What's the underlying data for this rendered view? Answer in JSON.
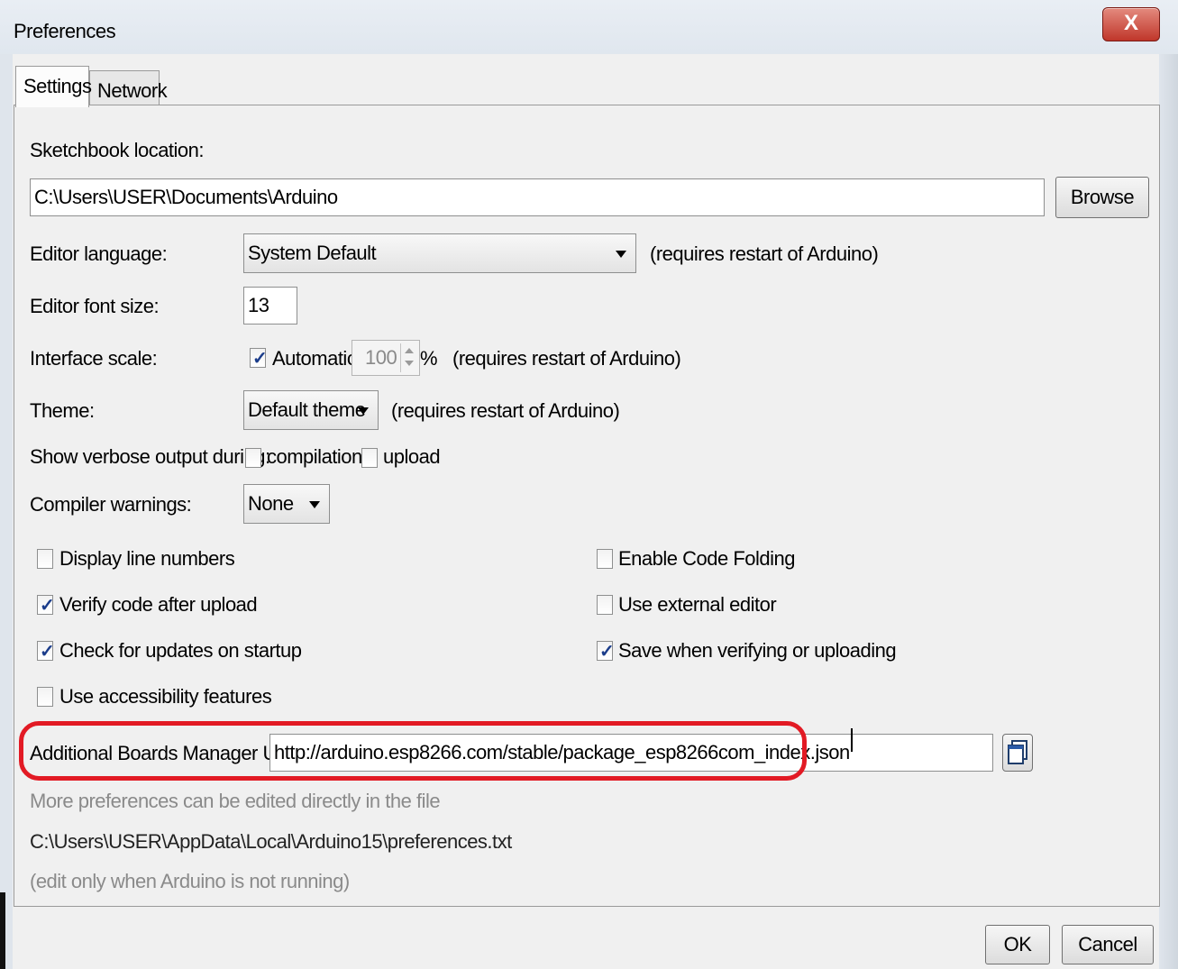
{
  "window": {
    "title": "Preferences",
    "close_label": "X"
  },
  "tabs": [
    {
      "label": "Settings",
      "active": true
    },
    {
      "label": "Network",
      "active": false
    }
  ],
  "sketchbook": {
    "label": "Sketchbook location:",
    "value": "C:\\Users\\USER\\Documents\\Arduino",
    "browse_label": "Browse"
  },
  "editor_language": {
    "label": "Editor language:",
    "selected": "System Default",
    "note": "(requires restart of Arduino)"
  },
  "editor_font_size": {
    "label": "Editor font size:",
    "value": "13"
  },
  "interface_scale": {
    "label": "Interface scale:",
    "automatic_label": "Automatic",
    "automatic_checked": true,
    "value": "100",
    "unit": "%",
    "note": "(requires restart of Arduino)"
  },
  "theme": {
    "label": "Theme:",
    "selected": "Default theme",
    "note": "(requires restart of Arduino)"
  },
  "verbose": {
    "label": "Show verbose output during:",
    "compilation_label": "compilation",
    "compilation_checked": false,
    "upload_label": "upload",
    "upload_checked": false
  },
  "compiler_warnings": {
    "label": "Compiler warnings:",
    "selected": "None"
  },
  "options_left": [
    {
      "label": "Display line numbers",
      "checked": false
    },
    {
      "label": "Verify code after upload",
      "checked": true
    },
    {
      "label": "Check for updates on startup",
      "checked": true
    },
    {
      "label": "Use accessibility features",
      "checked": false
    }
  ],
  "options_right": [
    {
      "label": "Enable Code Folding",
      "checked": false
    },
    {
      "label": "Use external editor",
      "checked": false
    },
    {
      "label": "Save when verifying or uploading",
      "checked": true
    }
  ],
  "boards_urls": {
    "label": "Additional Boards Manager URLs:",
    "value": "http://arduino.esp8266.com/stable/package_esp8266com_index.json"
  },
  "info": {
    "line1": "More preferences can be edited directly in the file",
    "path": "C:\\Users\\USER\\AppData\\Local\\Arduino15\\preferences.txt",
    "line3": "(edit only when Arduino is not running)"
  },
  "footer": {
    "ok_label": "OK",
    "cancel_label": "Cancel"
  },
  "colors": {
    "highlight": "#e21a24",
    "checkmark": "#1a3c8a"
  }
}
